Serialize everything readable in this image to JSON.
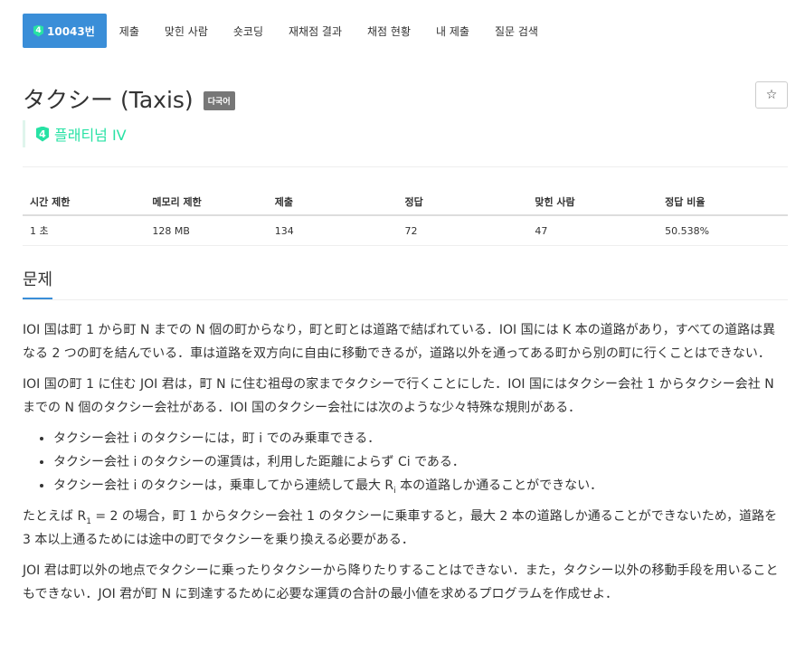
{
  "tabs": [
    {
      "label": "10043번",
      "active": true,
      "tier": "4"
    },
    {
      "label": "제출"
    },
    {
      "label": "맞힌 사람"
    },
    {
      "label": "숏코딩"
    },
    {
      "label": "재채점 결과"
    },
    {
      "label": "채점 현황"
    },
    {
      "label": "내 제출"
    },
    {
      "label": "질문 검색"
    }
  ],
  "problem": {
    "title": "タクシー (Taxis)",
    "lang_badge": "다국어",
    "star": "☆",
    "tier_num": "4",
    "tier_label": "플래티넘 IV",
    "tier_color": "#27e2a4"
  },
  "stats": {
    "headers": [
      "시간 제한",
      "메모리 제한",
      "제출",
      "정답",
      "맞힌 사람",
      "정답 비율"
    ],
    "values": [
      "1 초",
      "128 MB",
      "134",
      "72",
      "47",
      "50.538%"
    ]
  },
  "section": {
    "title": "문제",
    "p1": "IOI 国は町 1 から町 N までの N 個の町からなり，町と町とは道路で結ばれている．IOI 国には K 本の道路があり，すべての道路は異なる 2 つの町を結んでいる．車は道路を双方向に自由に移動できるが，道路以外を通ってある町から別の町に行くことはできない．",
    "p2": "IOI 国の町 1 に住む JOI 君は，町 N に住む祖母の家までタクシーで行くことにした．IOI 国にはタクシー会社 1 からタクシー会社 N までの N 個のタクシー会社がある．IOI 国のタクシー会社には次のような少々特殊な規則がある．",
    "li1": "タクシー会社 i のタクシーには，町 i でのみ乗車できる．",
    "li2": "タクシー会社 i のタクシーの運賃は，利用した距離によらず Ci である．",
    "li3_a": "タクシー会社 i のタクシーは，乗車してから連続して最大 R",
    "li3_sub": "i",
    "li3_b": " 本の道路しか通ることができない．",
    "p3_a": "たとえば R",
    "p3_sub": "1",
    "p3_b": " = 2 の場合，町 1 からタクシー会社 1 のタクシーに乗車すると，最大 2 本の道路しか通ることができないため，道路を 3 本以上通るためには途中の町でタクシーを乗り換える必要がある．",
    "p4": "JOI 君は町以外の地点でタクシーに乗ったりタクシーから降りたりすることはできない．また，タクシー以外の移動手段を用いることもできない．JOI 君が町 N に到達するために必要な運賃の合計の最小値を求めるプログラムを作成せよ．"
  }
}
